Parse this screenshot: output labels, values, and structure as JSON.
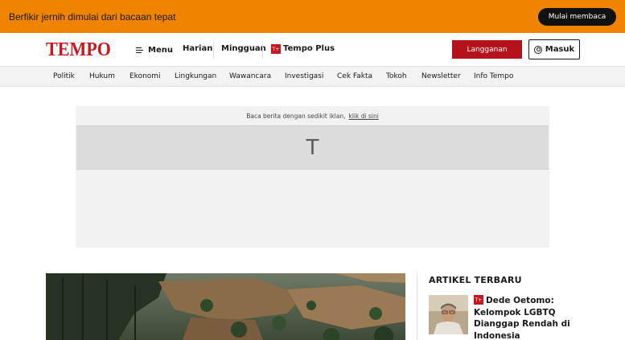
{
  "promo": {
    "text": "Berfikir jernih dimulai dari bacaan tepat",
    "button_label": "Mulai membaca"
  },
  "header": {
    "logo_text": "TEMPO",
    "menu_label": "Menu",
    "nav": [
      "Harian",
      "Mingguan",
      "Tempo Plus"
    ],
    "subscribe_label": "Langganan",
    "login_label": "Masuk"
  },
  "categories": [
    "Politik",
    "Hukum",
    "Ekonomi",
    "Lingkungan",
    "Wawancara",
    "Investigasi",
    "Cek Fakta",
    "Tokoh",
    "Newsletter",
    "Info Tempo"
  ],
  "ad": {
    "note": "Baca berita dengan sedikit iklan,",
    "link": "klik di sini",
    "placeholder_letter": "T"
  },
  "sidebar": {
    "title": "ARTIKEL TERBARU",
    "items": [
      {
        "headline": "Dede Oetomo: Kelompok LGBTQ Dianggap Rendah di Indonesia"
      }
    ]
  },
  "colors": {
    "promo_bg": "#f08400",
    "brand_red": "#c8171e",
    "subscribe_bg": "#b5121b"
  }
}
